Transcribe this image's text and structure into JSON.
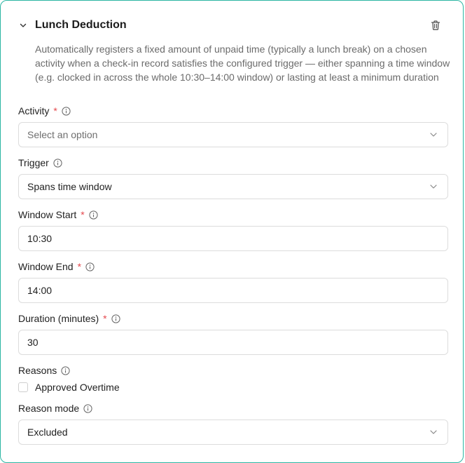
{
  "section": {
    "title": "Lunch Deduction",
    "description": "Automatically registers a fixed amount of unpaid time (typically a lunch break) on a chosen activity when a check-in record satisfies the configured trigger — either spanning a time window (e.g. clocked in across the whole 10:30–14:00 window) or lasting at least a minimum duration"
  },
  "fields": {
    "activity": {
      "label": "Activity",
      "required_mark": "*",
      "placeholder": "Select an option"
    },
    "trigger": {
      "label": "Trigger",
      "value": "Spans time window"
    },
    "window_start": {
      "label": "Window Start",
      "required_mark": "*",
      "value": "10:30"
    },
    "window_end": {
      "label": "Window End",
      "required_mark": "*",
      "value": "14:00"
    },
    "duration": {
      "label": "Duration (minutes)",
      "required_mark": "*",
      "value": "30"
    },
    "reasons": {
      "label": "Reasons",
      "option": "Approved Overtime",
      "checked": false
    },
    "reason_mode": {
      "label": "Reason mode",
      "value": "Excluded"
    }
  },
  "colors": {
    "accent_border": "#2bb6a3",
    "required": "#e5484d"
  },
  "icons": {
    "collapse": "chevron-down-icon",
    "delete": "trash-icon",
    "info": "info-icon",
    "dropdown": "chevron-down-icon"
  }
}
